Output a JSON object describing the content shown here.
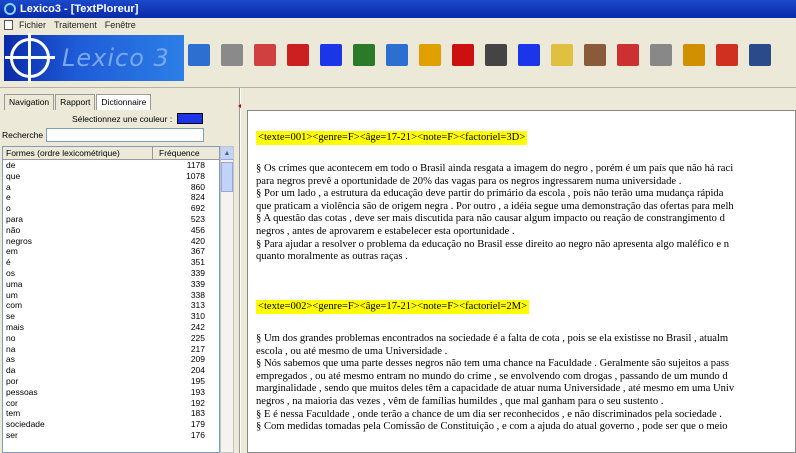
{
  "window": {
    "title": "Lexico3 - [TextPloreur]"
  },
  "menu": {
    "items": [
      "Fichier",
      "Traitement",
      "Fenêtre"
    ]
  },
  "toolbar": {
    "logo_text": "Lexico 3",
    "buttons": [
      {
        "name": "save-icon",
        "color": "#2d6fd0"
      },
      {
        "name": "tag-icon",
        "color": "#8a8a8a"
      },
      {
        "name": "grid-icon",
        "color": "#d04040"
      },
      {
        "name": "sr-icon",
        "color": "#cc2020"
      },
      {
        "name": "plcl-icon",
        "color": "#1b36e8"
      },
      {
        "name": "chart-icon",
        "color": "#2a7a2a"
      },
      {
        "name": "window-icon",
        "color": "#2d6fd0"
      },
      {
        "name": "dots-icon",
        "color": "#e0a000"
      },
      {
        "name": "cube-icon",
        "color": "#cc1010"
      },
      {
        "name": "document-icon",
        "color": "#444444"
      },
      {
        "name": "arrow-icon",
        "color": "#1b36e8"
      },
      {
        "name": "hand-icon",
        "color": "#e0c040"
      },
      {
        "name": "tags-icon",
        "color": "#8a5a3a"
      },
      {
        "name": "tools-icon",
        "color": "#cc3030"
      },
      {
        "name": "columns-icon",
        "color": "#888888"
      },
      {
        "name": "help-icon",
        "color": "#d09000"
      },
      {
        "name": "exit-icon",
        "color": "#d03020"
      },
      {
        "name": "stack-icon",
        "color": "#2a4a8a"
      }
    ]
  },
  "left": {
    "tabs": [
      "Navigation",
      "Rapport",
      "Dictionnaire"
    ],
    "active_tab": "Dictionnaire",
    "color_label": "Sélectionnez une couleur :",
    "color_value": "#1b36e8",
    "search_label": "Recherche :",
    "search_value": "",
    "columns": [
      "Formes (ordre lexicométrique)",
      "Fréquence"
    ],
    "rows": [
      [
        "de",
        "1178"
      ],
      [
        "que",
        "1078"
      ],
      [
        "a",
        "860"
      ],
      [
        "e",
        "824"
      ],
      [
        "o",
        "692"
      ],
      [
        "para",
        "523"
      ],
      [
        "não",
        "456"
      ],
      [
        "negros",
        "420"
      ],
      [
        "em",
        "367"
      ],
      [
        "é",
        "351"
      ],
      [
        "os",
        "339"
      ],
      [
        "uma",
        "339"
      ],
      [
        "um",
        "338"
      ],
      [
        "com",
        "313"
      ],
      [
        "se",
        "310"
      ],
      [
        "mais",
        "242"
      ],
      [
        "no",
        "225"
      ],
      [
        "na",
        "217"
      ],
      [
        "as",
        "209"
      ],
      [
        "da",
        "204"
      ],
      [
        "por",
        "195"
      ],
      [
        "pessoas",
        "193"
      ],
      [
        "cor",
        "192"
      ],
      [
        "tem",
        "183"
      ],
      [
        "sociedade",
        "179"
      ],
      [
        "ser",
        "176"
      ]
    ]
  },
  "document": {
    "header1": "<texte=001><genre=F><âge=17-21><note=F><factoriel=3D>",
    "lines1": [
      "§ Os crimes que acontecem em todo o Brasil ainda resgata a imagem do negro , porém é um país que não há raci",
      "para negros prevê a oportunidade de 20% das vagas para os negros ingressarem numa universidade .",
      "§ Por um lado , a estrutura da educação deve partir do primário da escola , pois não terão uma mudança rápida",
      "que praticam a violência são de origem negra . Por outro , a idéia segue uma demonstração das ofertas para melh",
      "§ A questão das cotas , deve ser mais discutida para não causar algum impacto ou reação de constrangimento d",
      "negros , antes de aprovarem e estabelecer esta oportunidade .",
      "§ Para ajudar a resolver o problema da educação no Brasil esse direito ao negro não apresenta algo maléfico e n",
      "quanto moralmente as outras raças ."
    ],
    "header2": "<texte=002><genre=F><âge=17-21><note=F><factoriel=2M>",
    "lines2": [
      "§ Um dos grandes problemas encontrados na sociedade é a falta de cota , pois se ela existisse no Brasil , atualm",
      "escola , ou até mesmo de uma Universidade .",
      "§ Nós sabemos que uma parte desses negros não tem uma chance na Faculdade . Geralmente são sujeitos a pass",
      "empregados , ou até mesmo entram no mundo do crime , se envolvendo com drogas , passando de um mundo d",
      "marginalidade , sendo que muitos deles têm a capacidade de atuar numa Universidade , até mesmo em uma Univ",
      "negros , na maioria das vezes , vêm de famílias humildes , que mal ganham para o seu sustento .",
      "§ E é nessa Faculdade , onde terão a chance de um dia ser reconhecidos , e não discriminados pela sociedade .",
      "§ Com medidas tomadas pela Comissão de Constituição , e com a ajuda do atual governo , pode ser que o meio"
    ]
  }
}
